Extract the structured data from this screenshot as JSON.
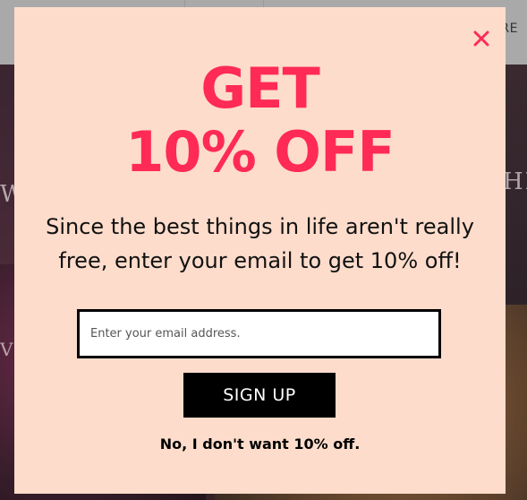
{
  "background": {
    "nav_text": "RE",
    "edge_text_left": "W",
    "edge_text_right": "HI",
    "edge_text_left2": "V"
  },
  "modal": {
    "headline_line1": "GET",
    "headline_line2": "10% OFF",
    "subtext": "Since the best things in life aren't really free, enter your email to get 10% off!",
    "email_placeholder": "Enter your email address.",
    "signup_label": "SIGN UP",
    "decline_label": "No, I don't want 10% off.",
    "close_icon": "close-icon"
  },
  "colors": {
    "modal_background": "#fddccb",
    "headline": "#ff2a56",
    "close_icon": "#ff2a56",
    "button_background": "#000000",
    "button_text": "#ffffff"
  }
}
